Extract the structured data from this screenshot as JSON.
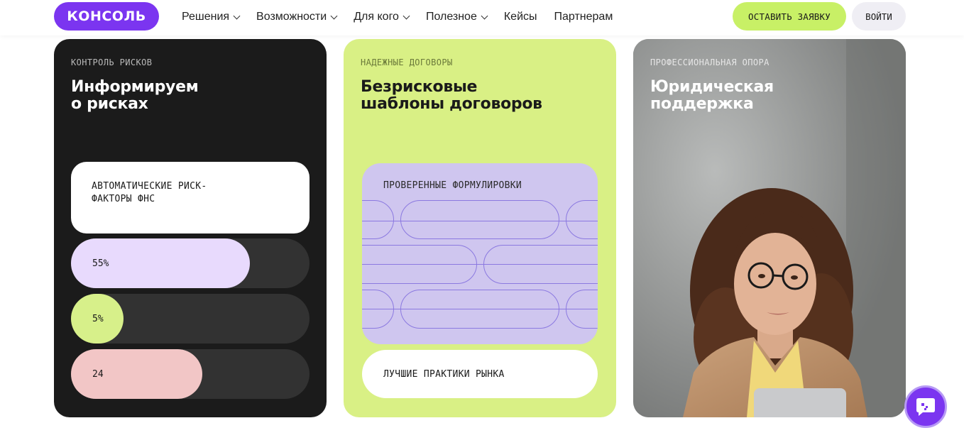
{
  "header": {
    "logo_text": "КОНСОЛЬ",
    "nav": [
      {
        "label": "Решения",
        "has_dropdown": true
      },
      {
        "label": "Возможности",
        "has_dropdown": true
      },
      {
        "label": "Для кого",
        "has_dropdown": true
      },
      {
        "label": "Полезное",
        "has_dropdown": true
      },
      {
        "label": "Кейсы",
        "has_dropdown": false
      },
      {
        "label": "Партнерам",
        "has_dropdown": false
      }
    ],
    "apply_label": "ОСТАВИТЬ ЗАЯВКУ",
    "login_label": "ВОЙТИ"
  },
  "cards": [
    {
      "eyebrow": "КОНТРОЛЬ РИСКОВ",
      "title_line1": "Информируем",
      "title_line2": "о рисках",
      "box_text_line1": "АВТОМАТИЧЕСКИЕ РИСК-",
      "box_text_line2": "ФАКТОРЫ ФНС",
      "bars": [
        {
          "label": "55%",
          "fill_fraction": 0.75,
          "color": "#e8dafd"
        },
        {
          "label": "5%",
          "fill_fraction": 0.22,
          "color": "#d7f08a"
        },
        {
          "label": "24",
          "fill_fraction": 0.55,
          "color": "#f2c6c6"
        }
      ]
    },
    {
      "eyebrow": "НАДЕЖНЫЕ ДОГОВОРЫ",
      "title_line1": "Безрисковые",
      "title_line2": "шаблоны договоров",
      "panel_label": "ПРОВЕРЕННЫЕ ФОРМУЛИРОВКИ",
      "pill_label": "ЛУЧШИЕ ПРАКТИКИ РЫНКА"
    },
    {
      "eyebrow": "ПРОФЕССИОНАЛЬНАЯ ОПОРА",
      "title_line1": "Юридическая",
      "title_line2": "поддержка",
      "image": "woman-with-glasses-photo"
    }
  ],
  "chat": {
    "icon": "chat-bubble-icon"
  },
  "colors": {
    "brand": "#7b35f0",
    "accent_green": "#c8f066",
    "card_dark": "#1b1b1b",
    "card_green": "#d9f085",
    "panel_purple": "#cfc6ef"
  }
}
